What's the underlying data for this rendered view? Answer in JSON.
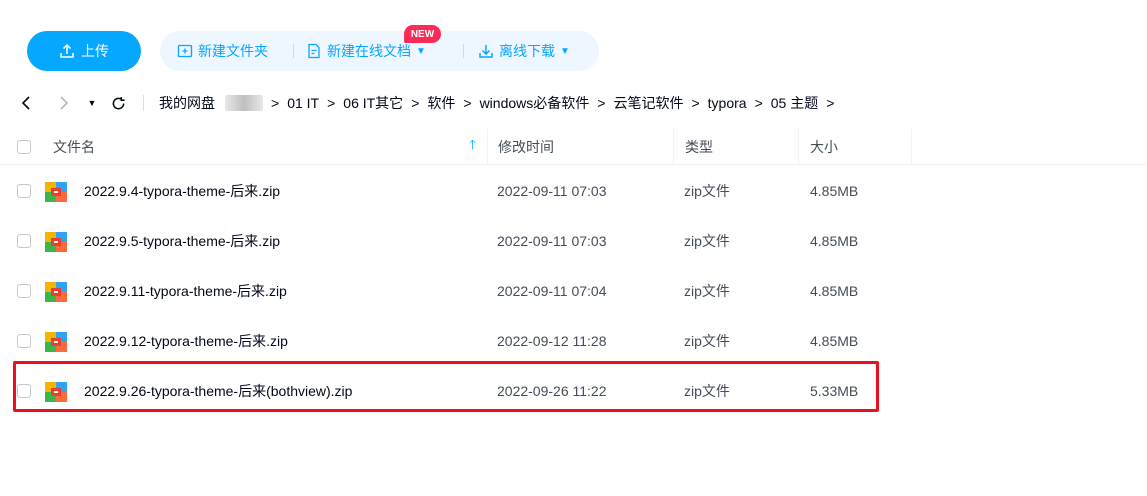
{
  "toolbar": {
    "upload_label": "上传",
    "new_folder_label": "新建文件夹",
    "new_online_doc_label": "新建在线文档",
    "new_badge": "NEW",
    "offline_download_label": "离线下载",
    "accent_color": "#06a7ff",
    "badge_color": "#fa2b57"
  },
  "breadcrumb": {
    "root": "我的网盘",
    "items": [
      "01 IT",
      "06 IT其它",
      "软件",
      "windows必备软件",
      "云笔记软件",
      "typora",
      "05 主题"
    ]
  },
  "table": {
    "headers": {
      "name": "文件名",
      "modified": "修改时间",
      "type": "类型",
      "size": "大小"
    },
    "rows": [
      {
        "name": "2022.9.4-typora-theme-后来.zip",
        "modified": "2022-09-11 07:03",
        "type": "zip文件",
        "size": "4.85MB"
      },
      {
        "name": "2022.9.5-typora-theme-后来.zip",
        "modified": "2022-09-11 07:03",
        "type": "zip文件",
        "size": "4.85MB"
      },
      {
        "name": "2022.9.11-typora-theme-后来.zip",
        "modified": "2022-09-11 07:04",
        "type": "zip文件",
        "size": "4.85MB"
      },
      {
        "name": "2022.9.12-typora-theme-后来.zip",
        "modified": "2022-09-12 11:28",
        "type": "zip文件",
        "size": "4.85MB"
      },
      {
        "name": "2022.9.26-typora-theme-后来(bothview).zip",
        "modified": "2022-09-26 11:22",
        "type": "zip文件",
        "size": "5.33MB"
      }
    ],
    "highlight_color": "#ea1020"
  }
}
